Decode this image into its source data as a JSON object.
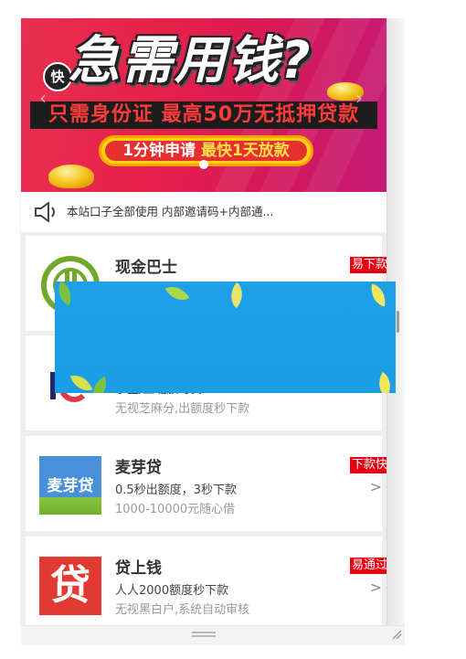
{
  "banner": {
    "badge": "快",
    "headline": "急需用钱?",
    "tagline": "只需身份证  最高50万无抵押贷款",
    "pill_part1": "1分钟申请",
    "pill_part2": "最快1天放款"
  },
  "notice": {
    "text": "本站口子全部使用 内部邀请码+内部通..."
  },
  "cards": [
    {
      "name": "现金巴士",
      "tag": "易下款",
      "line1": "",
      "line2": ""
    },
    {
      "name": "",
      "tag": "",
      "line1": "学生/上班族可贷",
      "line2": "无视芝麻分,出额度秒下款"
    },
    {
      "name": "麦芽贷",
      "tag": "下款快",
      "line1": "0.5秒出额度，3秒下款",
      "line2": "1000-10000元随心借",
      "logo_text": "麦芽贷"
    },
    {
      "name": "贷上钱",
      "tag": "易通过",
      "line1": "人人2000额度秒下款",
      "line2": "无视黑白户,系统自动审核",
      "logo_text": "贷"
    }
  ],
  "chevron": ">",
  "colors": {
    "tag_red": "#e60012",
    "overlay_blue": "#1ea0e8",
    "banner_red": "#e6204a"
  }
}
